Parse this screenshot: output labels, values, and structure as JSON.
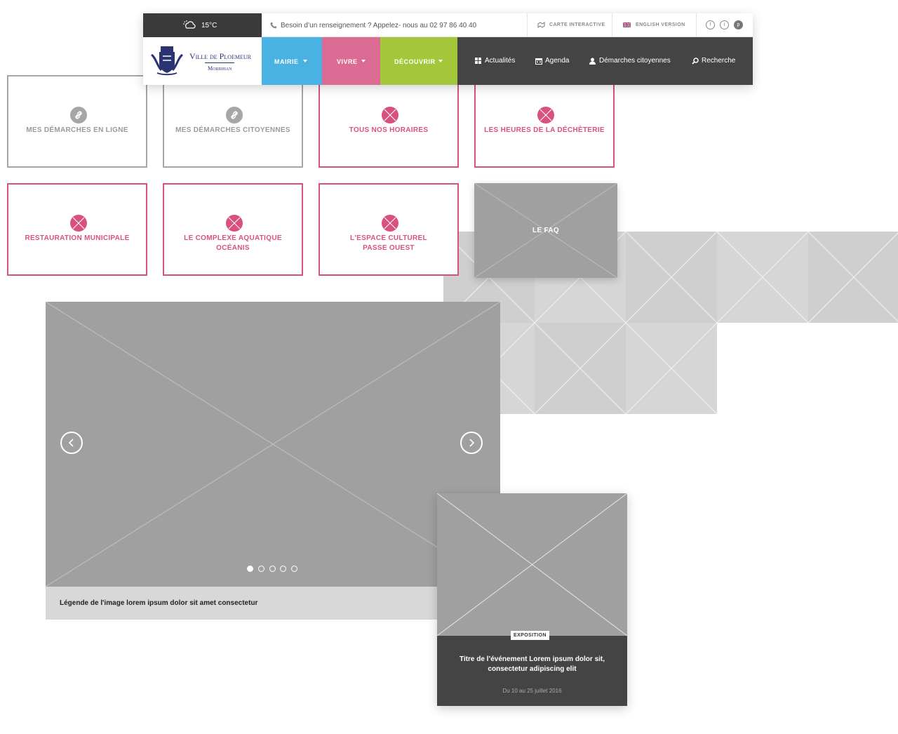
{
  "header": {
    "weather": {
      "temperature": "15°C",
      "icon": "cloud-sun-icon"
    },
    "phone": {
      "text": "Besoin d’un renseignement ? Appelez- nous au 02 97 86 40 40",
      "icon": "phone-icon"
    },
    "map_link": "CARTE INTERACTIVE",
    "english_link": "ENGLISH VERSION",
    "social": [
      {
        "name": "facebook",
        "glyph": "f"
      },
      {
        "name": "twitter",
        "glyph": "t"
      },
      {
        "name": "pinterest",
        "glyph": "p"
      }
    ],
    "logo": {
      "line1": "Ville de Ploemeur",
      "line2": "Morbihan"
    },
    "nav": [
      {
        "label": "MAIRIE",
        "color": "#4ab2e3"
      },
      {
        "label": "VIVRE",
        "color": "#dc6b93"
      },
      {
        "label": "DÉCOUVRIR",
        "color": "#a3c63b"
      }
    ],
    "utility": [
      {
        "label": "Actualités",
        "icon": "grid-icon"
      },
      {
        "label": "Agenda",
        "icon": "calendar-icon"
      },
      {
        "label": "Démarches citoyennes",
        "icon": "user-icon"
      },
      {
        "label": "Recherche",
        "icon": "search-icon"
      }
    ]
  },
  "tiles": [
    {
      "label": "MES DÉMARCHES EN LIGNE",
      "style": "grey",
      "icon": "link-icon"
    },
    {
      "label": "MES DÉMARCHES CITOYENNES",
      "style": "grey",
      "icon": "link-icon"
    },
    {
      "label": "TOUS NOS HORAIRES",
      "style": "pink",
      "icon": "placeholder-icon"
    },
    {
      "label": "LES HEURES DE LA DÉCHÈTERIE",
      "style": "pink",
      "icon": "placeholder-icon"
    },
    {
      "label": "RESTAURATION MUNICIPALE",
      "style": "pink",
      "icon": "placeholder-icon"
    },
    {
      "label": "LE COMPLEXE AQUATIQUE\nOCÉANIS",
      "style": "pink",
      "icon": "placeholder-icon"
    },
    {
      "label": "L'ESPACE CULTUREL\nPASSE OUEST",
      "style": "pink",
      "icon": "placeholder-icon"
    },
    {
      "label": "LE FAQ",
      "style": "image"
    }
  ],
  "slider": {
    "caption": "Légende de l'image lorem ipsum dolor sit amet consectetur",
    "slide_count": 5,
    "active_slide": 1
  },
  "event": {
    "badge": "EXPOSITION",
    "title": "Titre de l’événement Lorem ipsum dolor sit, consectetur adipiscing elit",
    "date": "Du 10 au 25 juillet 2016"
  },
  "colors": {
    "pink": "#d9527f",
    "dark": "#444444",
    "placeholder": "#a0a0a0"
  }
}
